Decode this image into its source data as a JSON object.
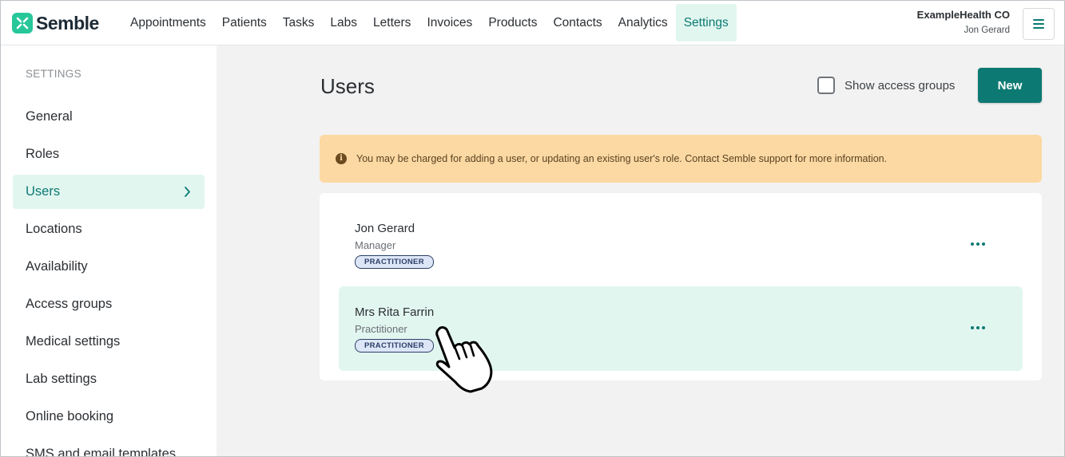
{
  "app": {
    "brand": "Semble",
    "accent_color": "#0c7a72",
    "brand_color": "#27c79a"
  },
  "header": {
    "nav": [
      {
        "label": "Appointments"
      },
      {
        "label": "Patients"
      },
      {
        "label": "Tasks"
      },
      {
        "label": "Labs"
      },
      {
        "label": "Letters"
      },
      {
        "label": "Invoices"
      },
      {
        "label": "Products"
      },
      {
        "label": "Contacts"
      },
      {
        "label": "Analytics"
      },
      {
        "label": "Settings",
        "active": true
      }
    ],
    "org_name": "ExampleHealth CO",
    "user_name": "Jon Gerard",
    "menu_icon": "hamburger-menu-icon"
  },
  "sidebar": {
    "heading": "SETTINGS",
    "items": [
      {
        "label": "General"
      },
      {
        "label": "Roles"
      },
      {
        "label": "Users",
        "active": true
      },
      {
        "label": "Locations"
      },
      {
        "label": "Availability"
      },
      {
        "label": "Access groups"
      },
      {
        "label": "Medical settings"
      },
      {
        "label": "Lab settings"
      },
      {
        "label": "Online booking"
      },
      {
        "label": "SMS and email templates"
      }
    ]
  },
  "main": {
    "title": "Users",
    "show_access_groups_label": "Show access groups",
    "show_access_groups_checked": false,
    "new_button_label": "New",
    "notice": "You may be charged for adding a user, or updating an existing user's role. Contact Semble support for more information.",
    "users": [
      {
        "name": "Jon Gerard",
        "role": "Manager",
        "badge": "PRACTITIONER"
      },
      {
        "name": "Mrs Rita Farrin",
        "role": "Practitioner",
        "badge": "PRACTITIONER",
        "hovered": true
      }
    ]
  }
}
